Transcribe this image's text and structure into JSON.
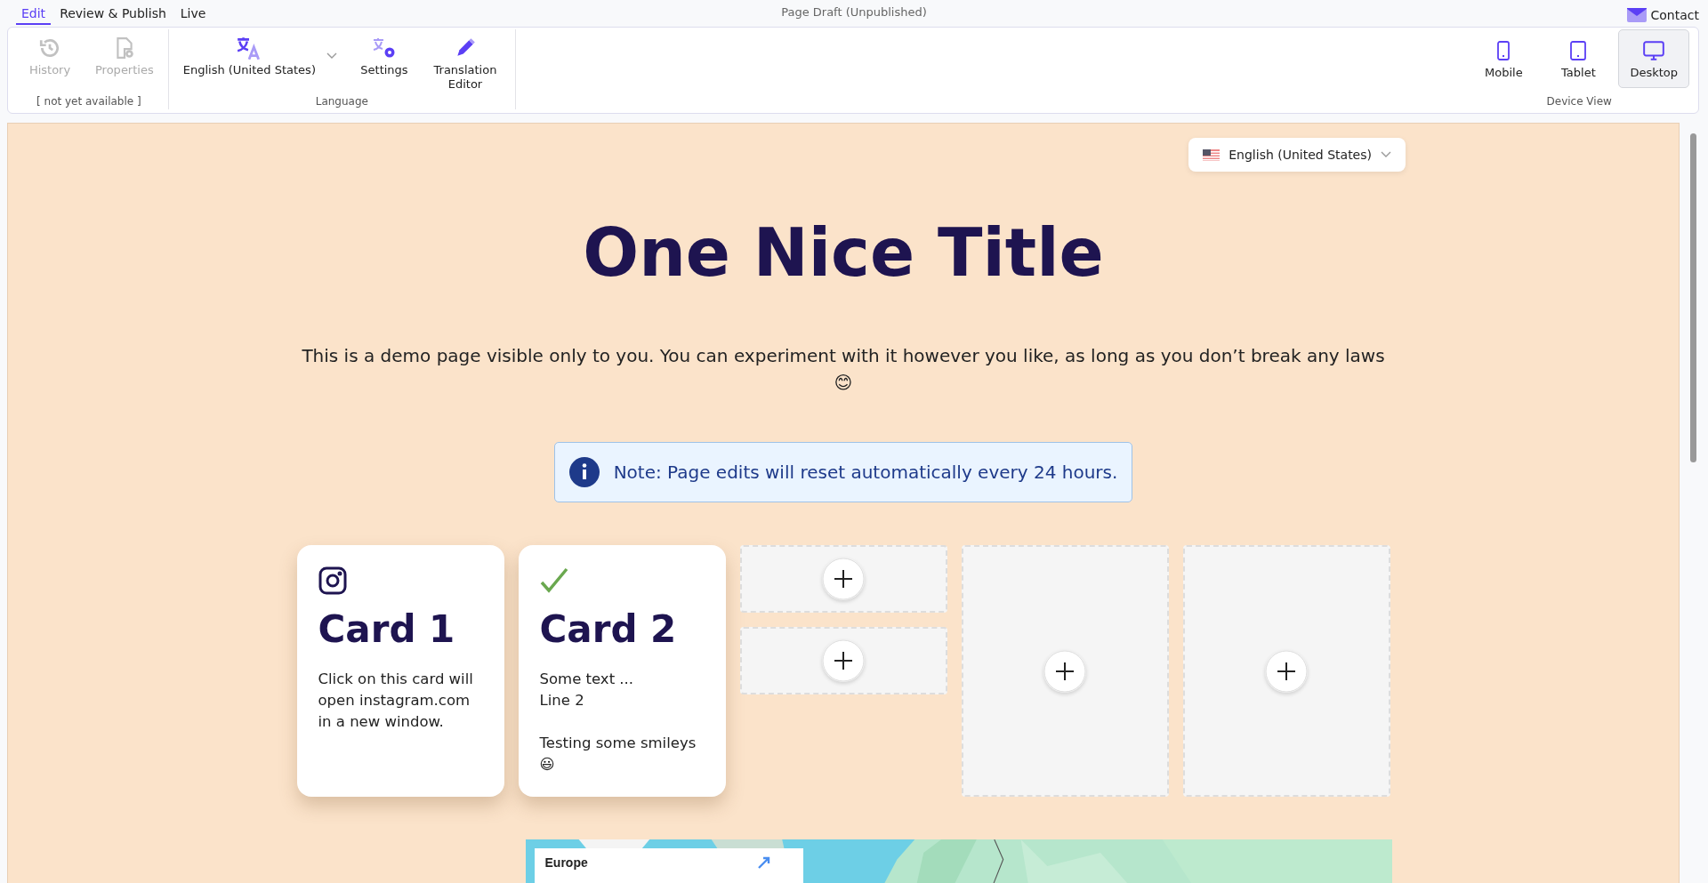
{
  "top_bar": {
    "tabs": [
      {
        "label": "Edit",
        "selected": true
      },
      {
        "label": "Review & Publish",
        "selected": false
      },
      {
        "label": "Live",
        "selected": false
      }
    ],
    "title": "Page Draft (Unpublished)",
    "contact": "Contact"
  },
  "ribbon": {
    "groups": [
      {
        "label": "[ not yet available ]",
        "items": [
          {
            "kind": "history",
            "label": "History",
            "disabled": true
          },
          {
            "kind": "properties",
            "label": "Properties",
            "disabled": true
          }
        ]
      },
      {
        "label": "Language",
        "items": [
          {
            "kind": "language",
            "label": "English (United States)",
            "disabled": false
          },
          {
            "kind": "settings",
            "label": "Settings",
            "disabled": false
          },
          {
            "kind": "editor",
            "label": "Translation Editor",
            "disabled": false
          }
        ]
      }
    ],
    "device_group": {
      "label": "Device View",
      "items": [
        {
          "kind": "mobile",
          "label": "Mobile",
          "selected": false
        },
        {
          "kind": "tablet",
          "label": "Tablet",
          "selected": false
        },
        {
          "kind": "desktop",
          "label": "Desktop",
          "selected": true
        }
      ]
    }
  },
  "page": {
    "language_select": "English (United States)",
    "title": "One Nice Title",
    "intro": "This is a demo page visible only to you. You can experiment with it however you like, as long as you don’t break any laws 😊",
    "note": "Note: Page edits will reset automatically every 24 hours.",
    "cards": [
      {
        "kind": "card",
        "title": "Card 1",
        "text": "Click on this card will open instagram.com in a new window."
      },
      {
        "kind": "card",
        "title": "Card 2",
        "text": "Some text ...\nLine 2\n\nTesting some smileys\n😃"
      },
      {
        "kind": "half_slot"
      },
      {
        "kind": "half_slot"
      },
      {
        "kind": "slot"
      },
      {
        "kind": "slot"
      }
    ],
    "map": {
      "card_title": "Europe"
    }
  }
}
